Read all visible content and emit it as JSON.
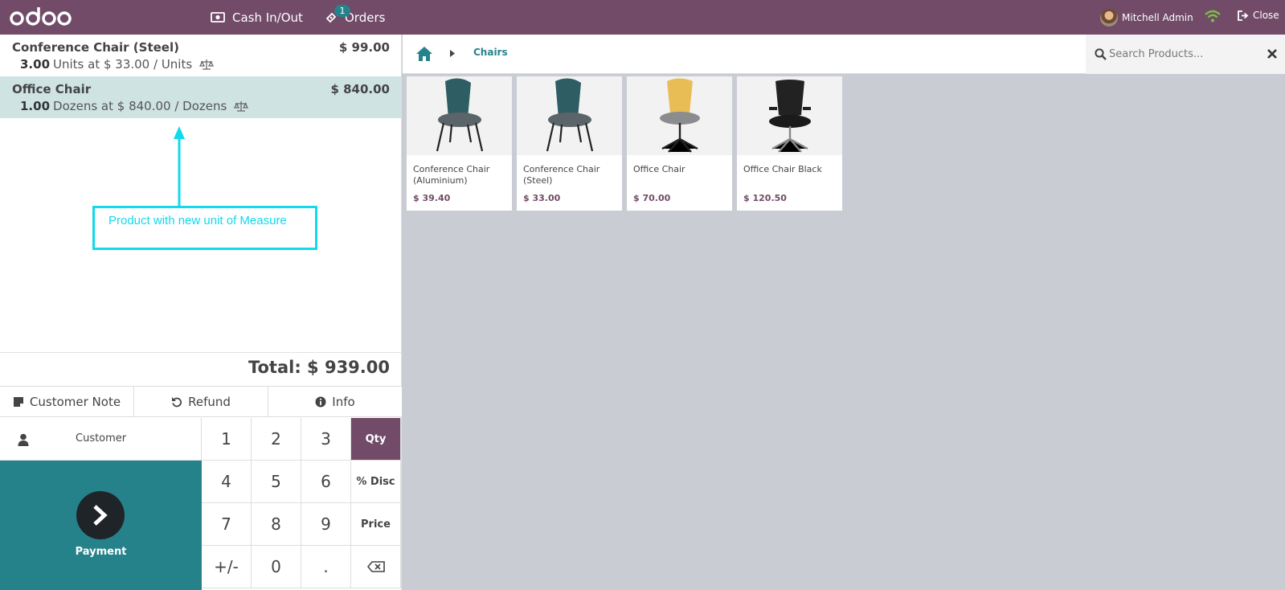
{
  "header": {
    "cash_label": "Cash In/Out",
    "orders_label": "Orders",
    "orders_count": "1",
    "user_name": "Mitchell Admin",
    "close_label": "Close"
  },
  "order_lines": [
    {
      "name": "Conference Chair (Steel)",
      "price": "$ 99.00",
      "qty": "3.00",
      "detail": "Units at $ 33.00 / Units"
    },
    {
      "name": "Office Chair",
      "price": "$ 840.00",
      "qty": "1.00",
      "detail": "Dozens at $ 840.00 / Dozens"
    }
  ],
  "annotation": {
    "text": "Product with new unit of Measure",
    "color": "#12d9eb"
  },
  "total": "Total: $ 939.00",
  "controls": {
    "customer_note": "Customer Note",
    "refund": "Refund",
    "info": "Info"
  },
  "customer_label": "Customer",
  "payment_label": "Payment",
  "numpad": {
    "keys": [
      "1",
      "2",
      "3",
      "4",
      "5",
      "6",
      "7",
      "8",
      "9",
      "+/-",
      "0",
      "."
    ],
    "modes": [
      "Qty",
      "% Disc",
      "Price"
    ],
    "active_mode": "Qty"
  },
  "breadcrumb": {
    "category": "Chairs"
  },
  "search": {
    "placeholder": "Search Products..."
  },
  "products": [
    {
      "name": "Conference Chair (Aluminium)",
      "price": "$ 39.40"
    },
    {
      "name": "Conference Chair (Steel)",
      "price": "$ 33.00"
    },
    {
      "name": "Office Chair",
      "price": "$ 70.00"
    },
    {
      "name": "Office Chair Black",
      "price": "$ 120.50"
    }
  ],
  "colors": {
    "brand": "#714b67",
    "teal": "#26838c",
    "selected_line": "#cfe3e3"
  }
}
